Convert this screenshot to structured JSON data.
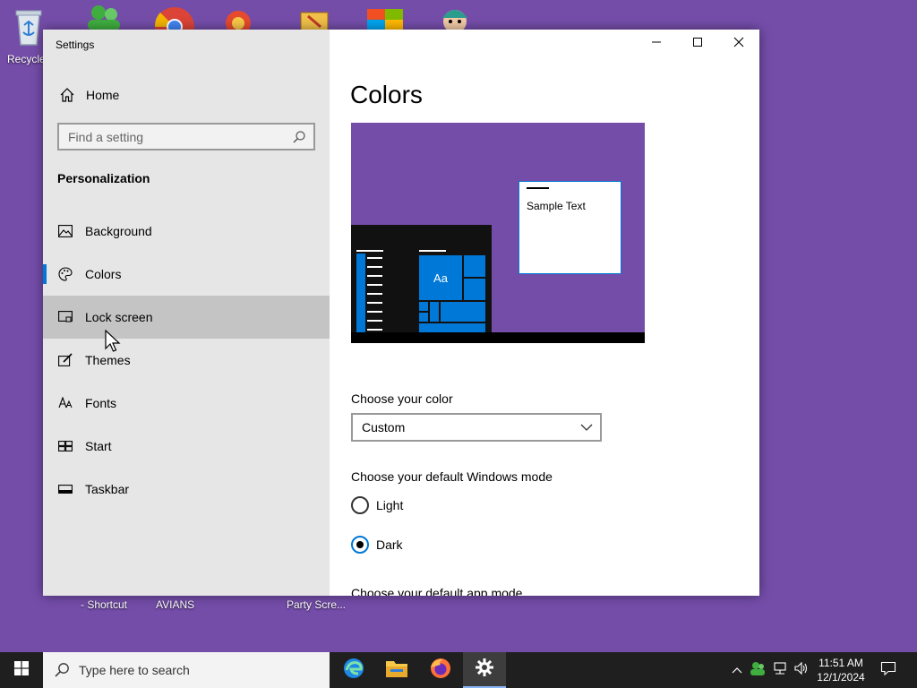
{
  "desktop": {
    "icons": [
      {
        "name": "recycle-bin",
        "label": "Recycle"
      },
      {
        "name": "people-app",
        "label": ""
      },
      {
        "name": "chrome",
        "label": ""
      },
      {
        "name": "app-3",
        "label": ""
      },
      {
        "name": "app-4",
        "label": ""
      },
      {
        "name": "app-5",
        "label": ""
      },
      {
        "name": "app-6",
        "label": ""
      }
    ],
    "bottom_labels": [
      "- Shortcut",
      "AVIANS",
      "Party Scre..."
    ]
  },
  "window": {
    "title": "Settings",
    "controls": [
      "minimize-icon",
      "maximize-icon",
      "close-icon"
    ]
  },
  "sidebar": {
    "home_label": "Home",
    "search_placeholder": "Find a setting",
    "section_title": "Personalization",
    "items": [
      {
        "label": "Background",
        "icon": "background-icon"
      },
      {
        "label": "Colors",
        "icon": "palette-icon"
      },
      {
        "label": "Lock screen",
        "icon": "lock-screen-icon"
      },
      {
        "label": "Themes",
        "icon": "themes-icon"
      },
      {
        "label": "Fonts",
        "icon": "fonts-icon"
      },
      {
        "label": "Start",
        "icon": "start-icon"
      },
      {
        "label": "Taskbar",
        "icon": "taskbar-icon"
      }
    ],
    "selected": "Colors",
    "hovered": "Lock screen"
  },
  "content": {
    "title": "Colors",
    "preview": {
      "sample_text": "Sample Text",
      "tile_text": "Aa",
      "accent": "#0078d7",
      "background": "#744da9"
    },
    "choose_color_label": "Choose your color",
    "choose_color_value": "Custom",
    "windows_mode_label": "Choose your default Windows mode",
    "windows_mode_options": [
      "Light",
      "Dark"
    ],
    "windows_mode_selected": "Dark",
    "app_mode_label": "Choose your default app mode"
  },
  "taskbar": {
    "search_placeholder": "Type here to search",
    "apps": [
      "edge-icon",
      "file-explorer-icon",
      "firefox-icon",
      "settings-icon"
    ],
    "active_app": "settings-icon",
    "time": "11:51 AM",
    "date": "12/1/2024"
  },
  "colors": {
    "desktop": "#744da9",
    "accent": "#0078d7",
    "sidebar": "#e6e6e6",
    "hover": "#c4c4c4",
    "taskbar": "#1f1f1f"
  }
}
